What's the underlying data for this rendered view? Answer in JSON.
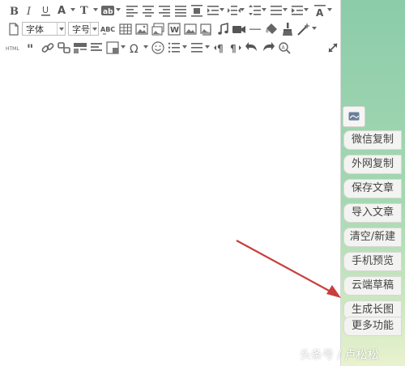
{
  "toolbar": {
    "font_family_value": "字体",
    "font_size_value": "字号",
    "html_label": "HTML",
    "spellcheck_label": "ABC",
    "icons_row1": [
      "bold-icon",
      "italic-icon",
      "underline-icon",
      "font-color-icon",
      "text-style-icon",
      "highlight-icon",
      "align-left-icon",
      "align-center-icon",
      "align-right-icon",
      "align-justify-icon",
      "align-top-icon",
      "indent-left-icon",
      "indent-both-icon",
      "line-height-icon",
      "paragraph-spacing-icon",
      "indent-icon",
      "clear-format-icon"
    ],
    "icons_row2": [
      "new-doc-icon",
      "table-icon",
      "image-icon",
      "image-multi-icon",
      "word-import-icon",
      "image-edit-icon",
      "gallery-icon",
      "music-icon",
      "video-icon",
      "hr-icon",
      "eraser-icon",
      "brush-icon",
      "magic-icon"
    ],
    "icons_row3": [
      "quote-icon",
      "link-icon",
      "unlink-icon",
      "template-icon",
      "block-icon",
      "frame-icon",
      "omega-icon",
      "emoji-icon",
      "ordered-list-icon",
      "unordered-list-icon",
      "paragraph-ltr-icon",
      "paragraph-rtl-icon",
      "undo-icon",
      "redo-icon",
      "search-replace-icon"
    ]
  },
  "side_menu": {
    "items": [
      "微信复制",
      "外网复制",
      "保存文章",
      "导入文章",
      "清空/新建",
      "手机预览",
      "云端草稿",
      "生成长图",
      "更多功能"
    ]
  },
  "watermark": "头条号 / 卢松松"
}
